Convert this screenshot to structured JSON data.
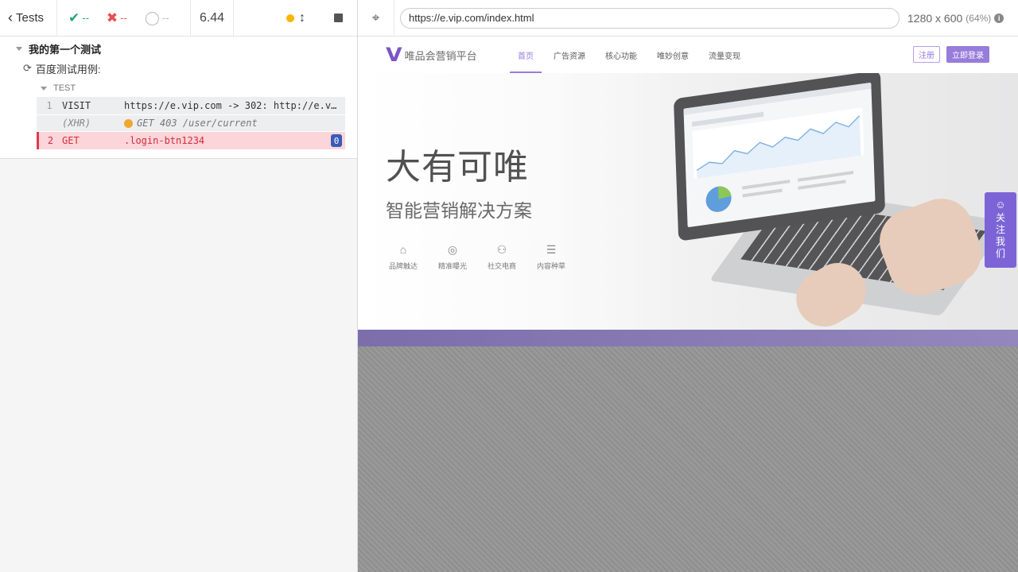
{
  "reporter": {
    "tests_label": "Tests",
    "stats": {
      "passed": "--",
      "failed": "--",
      "pending": "--"
    },
    "duration": "6.44",
    "suite_title": "我的第一个测试",
    "test_title": "百度测试用例:",
    "test_label": "TEST",
    "commands": [
      {
        "num": "1",
        "name": "VISIT",
        "message": "https://e.vip.com -> 302: http://e.v…"
      },
      {
        "num": "",
        "name": "(XHR)",
        "message": "GET 403 /user/current"
      },
      {
        "num": "2",
        "name": "GET",
        "message": ".login-btn1234",
        "badge": "0"
      }
    ]
  },
  "aut": {
    "url": "https://e.vip.com/index.html",
    "viewport_size": "1280 x 600",
    "scale": "(64%)",
    "info_icon": "i"
  },
  "site": {
    "logo_text": "唯品会营销平台",
    "nav": [
      "首页",
      "广告资源",
      "核心功能",
      "唯妙创意",
      "流量变现"
    ],
    "register": "注册",
    "login": "立即登录",
    "hero_title": "大有可唯",
    "hero_subtitle": "智能营销解决方案",
    "features": [
      "品牌触达",
      "精准曝光",
      "社交电商",
      "内容种草"
    ],
    "follow": [
      "关",
      "注",
      "我",
      "们"
    ]
  },
  "colors": {
    "pass": "#1fa971",
    "fail": "#e94f4f",
    "brand": "#8a6ad6",
    "error_row": "#fbd5d9"
  }
}
